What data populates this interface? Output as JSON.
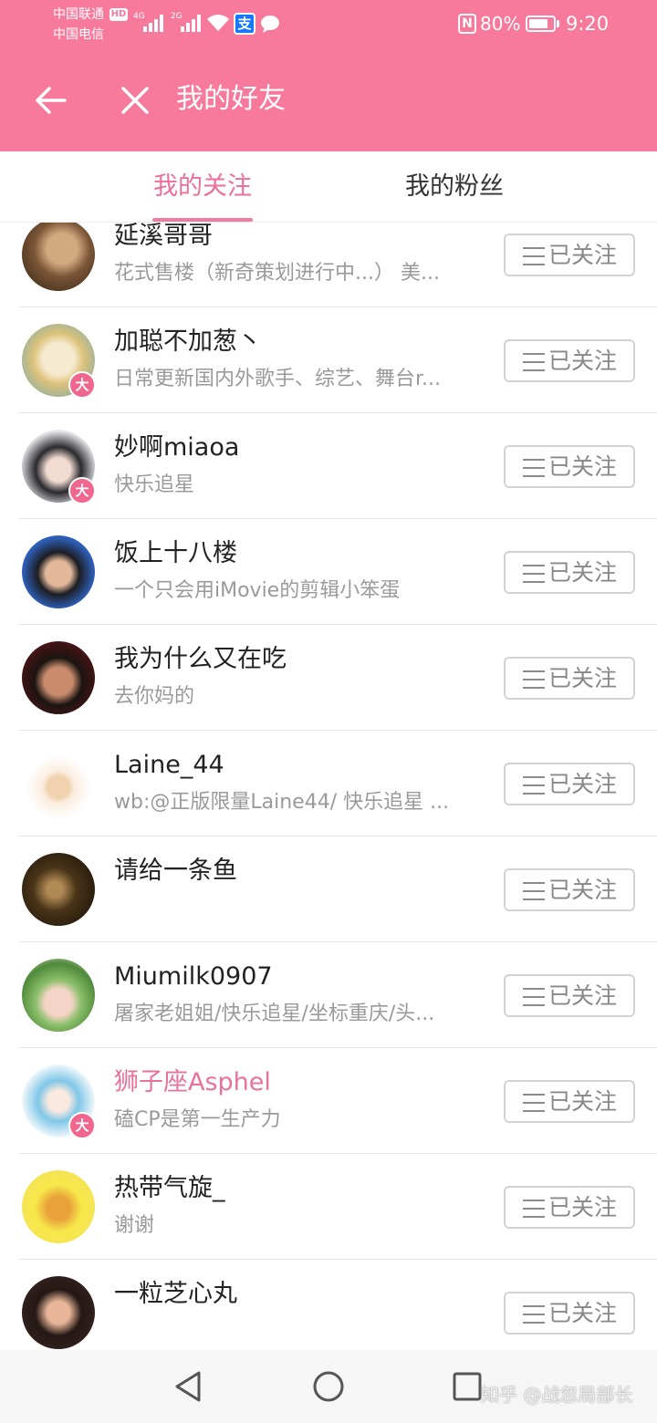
{
  "status_bar": {
    "carrier_primary": "中国联通",
    "carrier_primary_badge": "HD",
    "carrier_secondary": "中国电信",
    "network_primary": "4G",
    "network_secondary": "2G",
    "alipay_glyph": "支",
    "nfc_glyph": "N",
    "battery_percent": "80%",
    "battery_level": 0.8,
    "time": "9:20",
    "icons": [
      "signal-icon",
      "wifi-icon",
      "alipay-icon",
      "chat-bubble-icon",
      "nfc-icon",
      "battery-icon"
    ]
  },
  "header": {
    "title": "我的好友",
    "back_icon": "arrow-left-icon",
    "close_icon": "close-icon"
  },
  "tabs": [
    {
      "label": "我的关注",
      "active": true
    },
    {
      "label": "我的粉丝",
      "active": false
    }
  ],
  "follow_list": {
    "button_label": "已关注",
    "button_icon": "menu-icon",
    "badge_label": "大",
    "items": [
      {
        "name": "延溪哥哥",
        "bio": "花式售楼（新奇策划进行中...） 美...",
        "badge": false,
        "highlighted": false
      },
      {
        "name": "加聪不加葱丶",
        "bio": "日常更新国内外歌手、综艺、舞台r...",
        "badge": true,
        "highlighted": false
      },
      {
        "name": "妙啊miaoa",
        "bio": "快乐追星",
        "badge": true,
        "highlighted": false
      },
      {
        "name": "饭上十八楼",
        "bio": "一个只会用iMovie的剪辑小笨蛋",
        "badge": false,
        "highlighted": false
      },
      {
        "name": "我为什么又在吃",
        "bio": "去你妈的",
        "badge": false,
        "highlighted": false
      },
      {
        "name": "Laine_44",
        "bio": "wb:@正版限量Laine44/ 快乐追星 ...",
        "badge": false,
        "highlighted": false
      },
      {
        "name": "请给一条鱼",
        "bio": "",
        "badge": false,
        "highlighted": false
      },
      {
        "name": "Miumilk0907",
        "bio": "屠家老姐姐/快乐追星/坐标重庆/头...",
        "badge": false,
        "highlighted": false
      },
      {
        "name": "狮子座Asphel",
        "bio": "磕CP是第一生产力",
        "badge": true,
        "highlighted": true
      },
      {
        "name": "热带气旋_",
        "bio": "谢谢",
        "badge": false,
        "highlighted": false
      },
      {
        "name": "一粒芝心丸",
        "bio": "",
        "badge": false,
        "highlighted": false
      }
    ]
  },
  "nav_bar": {
    "icons": [
      "back-triangle-icon",
      "home-circle-icon",
      "recent-apps-square-icon"
    ]
  },
  "watermark": "知乎 @战忽局部长",
  "colors": {
    "brand_pink": "#f7799c",
    "active_tab": "#ec6f97",
    "highlight_name": "#e8729a",
    "badge": "#f0668e"
  }
}
